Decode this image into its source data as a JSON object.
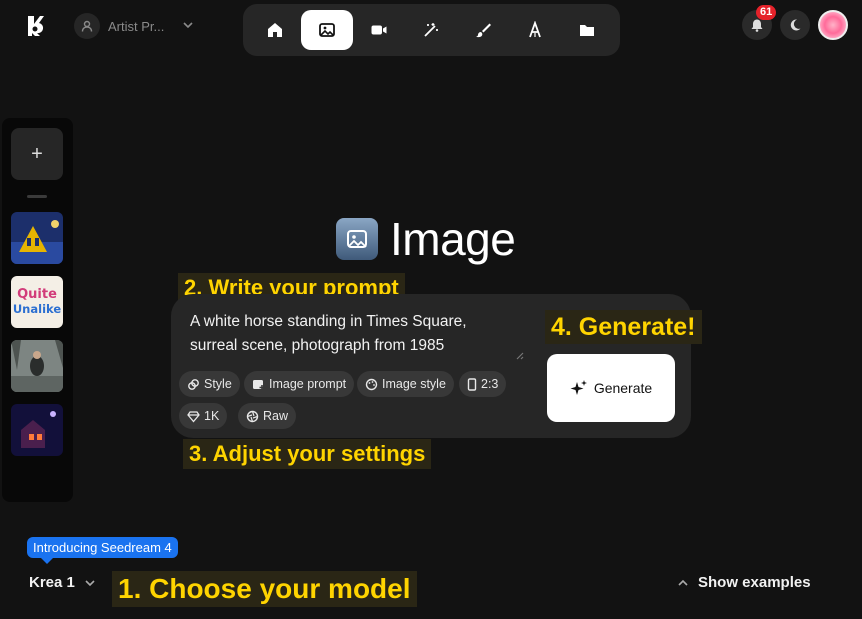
{
  "topbar": {
    "workspace_label": "Artist Pr...",
    "notifications_count": "61",
    "tools": [
      "home-icon",
      "image-icon",
      "video-icon",
      "enhance-icon",
      "edit-icon",
      "font-icon",
      "folder-icon"
    ],
    "active_tool": "image-icon"
  },
  "sidebar": {
    "add_label": "+",
    "thumb2_line1": "Quite",
    "thumb2_line2": "Unalike"
  },
  "main": {
    "title": "Image",
    "prompt_text": "A white horse standing in Times Square, surreal scene, photograph from 1985",
    "chips": {
      "style": "Style",
      "image_prompt": "Image prompt",
      "image_style": "Image style",
      "aspect": "2:3",
      "resolution": "1K",
      "raw": "Raw"
    },
    "generate_label": "Generate"
  },
  "annotations": {
    "step1": "1. Choose your model",
    "step2": "2. Write your prompt",
    "step3": "3. Adjust your settings",
    "step4": "4. Generate!"
  },
  "bottom": {
    "intro_badge": "Introducing Seedream 4",
    "model_name": "Krea 1",
    "show_examples": "Show examples"
  },
  "colors": {
    "background": "#121212",
    "panel": "#262626",
    "accent_yellow": "#ffd400",
    "badge_blue": "#1a73f0",
    "notification_red": "#e5222a"
  }
}
